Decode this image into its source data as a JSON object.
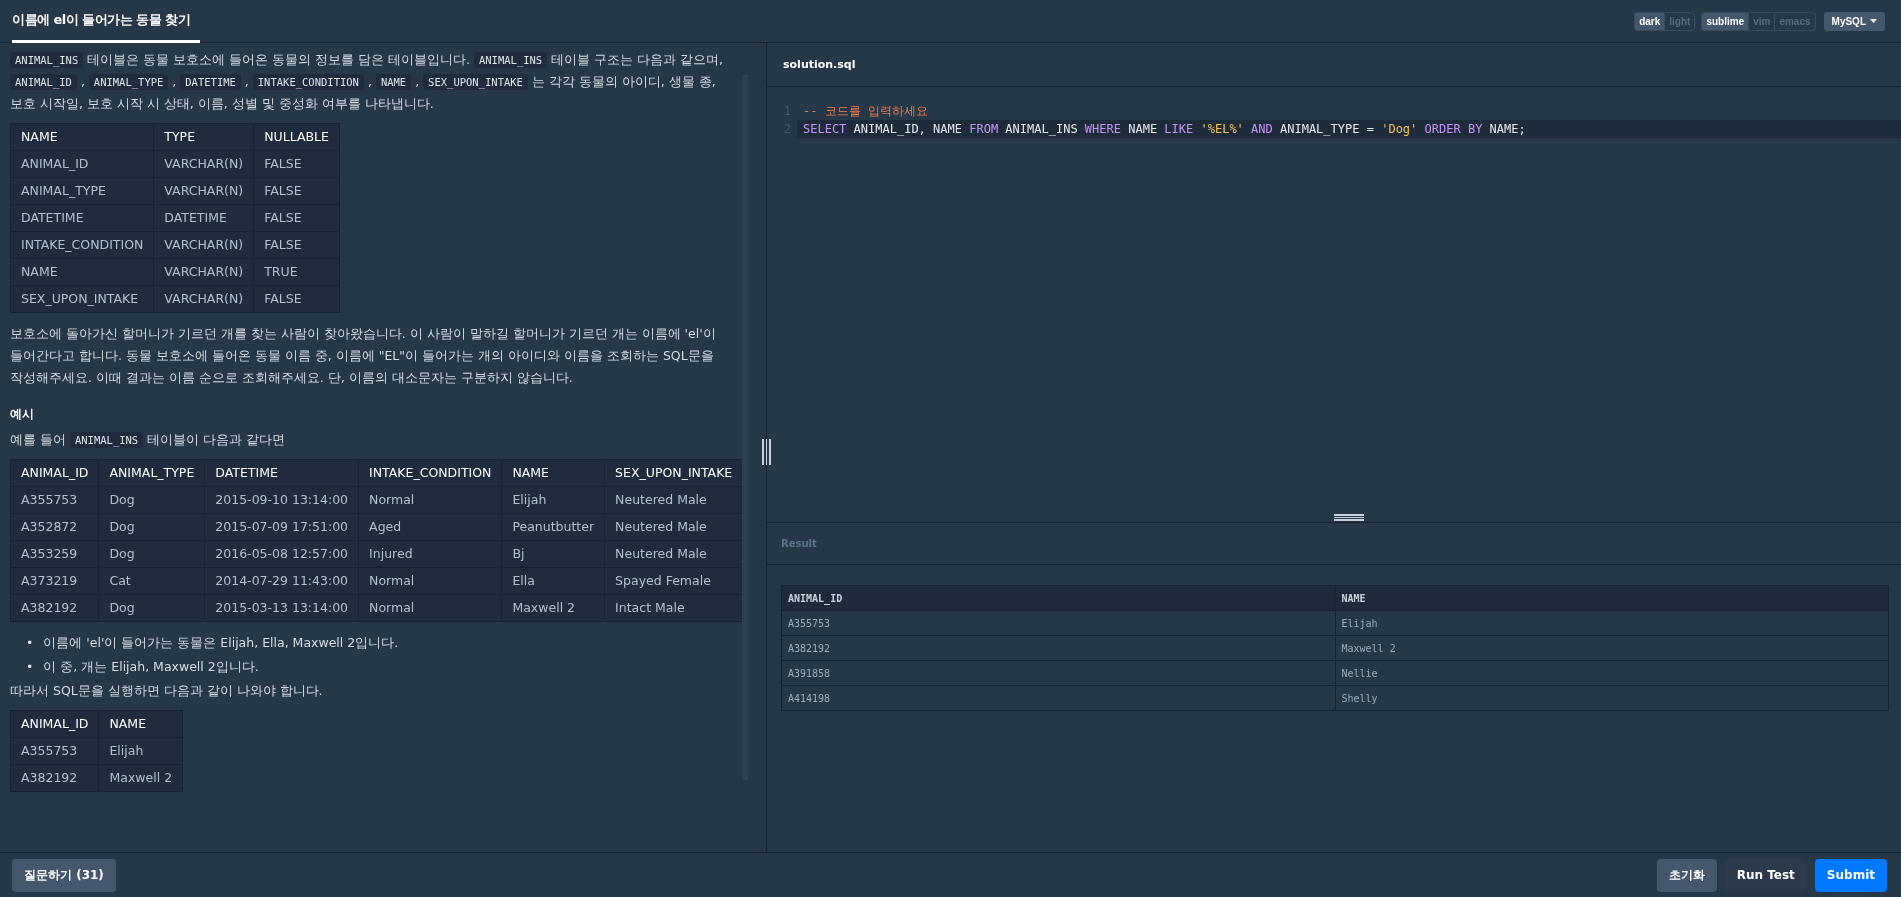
{
  "title": "이름에 el이 들어가는 동물 찾기",
  "toggle_groups": [
    [
      {
        "label": "dark",
        "selected": true
      },
      {
        "label": "light",
        "selected": false
      }
    ],
    [
      {
        "label": "sublime",
        "selected": true
      },
      {
        "label": "vim",
        "selected": false
      },
      {
        "label": "emacs",
        "selected": false
      }
    ]
  ],
  "language": "MySQL",
  "description": {
    "intro": [
      {
        "kind": "code",
        "text": "ANIMAL_INS"
      },
      {
        "kind": "text",
        "text": " 테이블은 동물 보호소에 들어온 동물의 정보를 담은 테이블입니다. "
      },
      {
        "kind": "code",
        "text": "ANIMAL_INS"
      },
      {
        "kind": "text",
        "text": " 테이블 구조는 다음과 같으며, "
      },
      {
        "kind": "code",
        "text": "ANIMAL_ID"
      },
      {
        "kind": "text",
        "text": " , "
      },
      {
        "kind": "code",
        "text": "ANIMAL_TYPE"
      },
      {
        "kind": "text",
        "text": " , "
      },
      {
        "kind": "code",
        "text": "DATETIME"
      },
      {
        "kind": "text",
        "text": " , "
      },
      {
        "kind": "code",
        "text": "INTAKE_CONDITION"
      },
      {
        "kind": "text",
        "text": " , "
      },
      {
        "kind": "code",
        "text": "NAME"
      },
      {
        "kind": "text",
        "text": " , "
      },
      {
        "kind": "code",
        "text": "SEX_UPON_INTAKE"
      },
      {
        "kind": "text",
        "text": " 는 각각 동물의 아이디, 생물 종, 보호 시작일, 보호 시작 시 상태, 이름, 성별 및 중성화 여부를 나타냅니다."
      }
    ],
    "schema_table": {
      "columns": [
        "NAME",
        "TYPE",
        "NULLABLE"
      ],
      "rows": [
        [
          "ANIMAL_ID",
          "VARCHAR(N)",
          "FALSE"
        ],
        [
          "ANIMAL_TYPE",
          "VARCHAR(N)",
          "FALSE"
        ],
        [
          "DATETIME",
          "DATETIME",
          "FALSE"
        ],
        [
          "INTAKE_CONDITION",
          "VARCHAR(N)",
          "FALSE"
        ],
        [
          "NAME",
          "VARCHAR(N)",
          "TRUE"
        ],
        [
          "SEX_UPON_INTAKE",
          "VARCHAR(N)",
          "FALSE"
        ]
      ]
    },
    "problem": "보호소에 돌아가신 할머니가 기르던 개를 찾는 사람이 찾아왔습니다. 이 사람이 말하길 할머니가 기르던 개는 이름에 'el'이 들어간다고 합니다. 동물 보호소에 들어온 동물 이름 중, 이름에 \"EL\"이 들어가는 개의 아이디와 이름을 조회하는 SQL문을 작성해주세요. 이때 결과는 이름 순으로 조회해주세요. 단, 이름의 대소문자는 구분하지 않습니다.",
    "example_heading": "예시",
    "example_intro": [
      {
        "kind": "text",
        "text": "예를 들어 "
      },
      {
        "kind": "code",
        "text": "ANIMAL_INS"
      },
      {
        "kind": "text",
        "text": " 테이블이 다음과 같다면"
      }
    ],
    "example_table": {
      "columns": [
        "ANIMAL_ID",
        "ANIMAL_TYPE",
        "DATETIME",
        "INTAKE_CONDITION",
        "NAME",
        "SEX_UPON_INTAKE"
      ],
      "rows": [
        [
          "A355753",
          "Dog",
          "2015-09-10 13:14:00",
          "Normal",
          "Elijah",
          "Neutered Male"
        ],
        [
          "A352872",
          "Dog",
          "2015-07-09 17:51:00",
          "Aged",
          "Peanutbutter",
          "Neutered Male"
        ],
        [
          "A353259",
          "Dog",
          "2016-05-08 12:57:00",
          "Injured",
          "Bj",
          "Neutered Male"
        ],
        [
          "A373219",
          "Cat",
          "2014-07-29 11:43:00",
          "Normal",
          "Ella",
          "Spayed Female"
        ],
        [
          "A382192",
          "Dog",
          "2015-03-13 13:14:00",
          "Normal",
          "Maxwell 2",
          "Intact Male"
        ]
      ]
    },
    "bullets": [
      {
        "marker": "•",
        "text": "이름에 'el'이 들어가는 동물은 Elijah, Ella, Maxwell 2입니다."
      },
      {
        "marker": "•",
        "text": "이 중, 개는 Elijah, Maxwell 2입니다."
      }
    ],
    "conclusion": "따라서 SQL문을 실행하면 다음과 같이 나와야 합니다.",
    "answer_table": {
      "columns": [
        "ANIMAL_ID",
        "NAME"
      ],
      "rows": [
        [
          "A355753",
          "Elijah"
        ],
        [
          "A382192",
          "Maxwell 2"
        ]
      ]
    }
  },
  "editor": {
    "filename": "solution.sql",
    "lines": [
      {
        "number": "1",
        "active": false,
        "tokens": [
          {
            "kind": "comment",
            "text": "-- 코드를 입력하세요"
          }
        ]
      },
      {
        "number": "2",
        "active": true,
        "tokens": [
          {
            "kind": "keyword",
            "text": "SELECT"
          },
          {
            "kind": "ident",
            "text": "ANIMAL_ID,"
          },
          {
            "kind": "ident",
            "text": "NAME"
          },
          {
            "kind": "keyword",
            "text": "FROM"
          },
          {
            "kind": "ident",
            "text": "ANIMAL_INS"
          },
          {
            "kind": "keyword",
            "text": "WHERE"
          },
          {
            "kind": "ident",
            "text": "NAME"
          },
          {
            "kind": "keyword",
            "text": "LIKE"
          },
          {
            "kind": "string",
            "text": "'%EL%'"
          },
          {
            "kind": "keyword",
            "text": "AND"
          },
          {
            "kind": "ident",
            "text": "ANIMAL_TYPE"
          },
          {
            "kind": "ident",
            "text": "="
          },
          {
            "kind": "string",
            "text": "'Dog'"
          },
          {
            "kind": "keyword",
            "text": "ORDER"
          },
          {
            "kind": "keyword",
            "text": "BY"
          },
          {
            "kind": "ident",
            "text": "NAME;"
          }
        ]
      }
    ]
  },
  "result": {
    "label": "Result",
    "columns": [
      "ANIMAL_ID",
      "NAME"
    ],
    "rows": [
      [
        "A355753",
        "Elijah"
      ],
      [
        "A382192",
        "Maxwell 2"
      ],
      [
        "A391858",
        "Nellie"
      ],
      [
        "A414198",
        "Shelly"
      ]
    ]
  },
  "footer": {
    "ask_button": "질문하기 (31)",
    "buttons": [
      {
        "kind": "reset",
        "label": "초기화"
      },
      {
        "kind": "run",
        "label": "Run Test"
      },
      {
        "kind": "submit",
        "label": "Submit"
      }
    ]
  }
}
